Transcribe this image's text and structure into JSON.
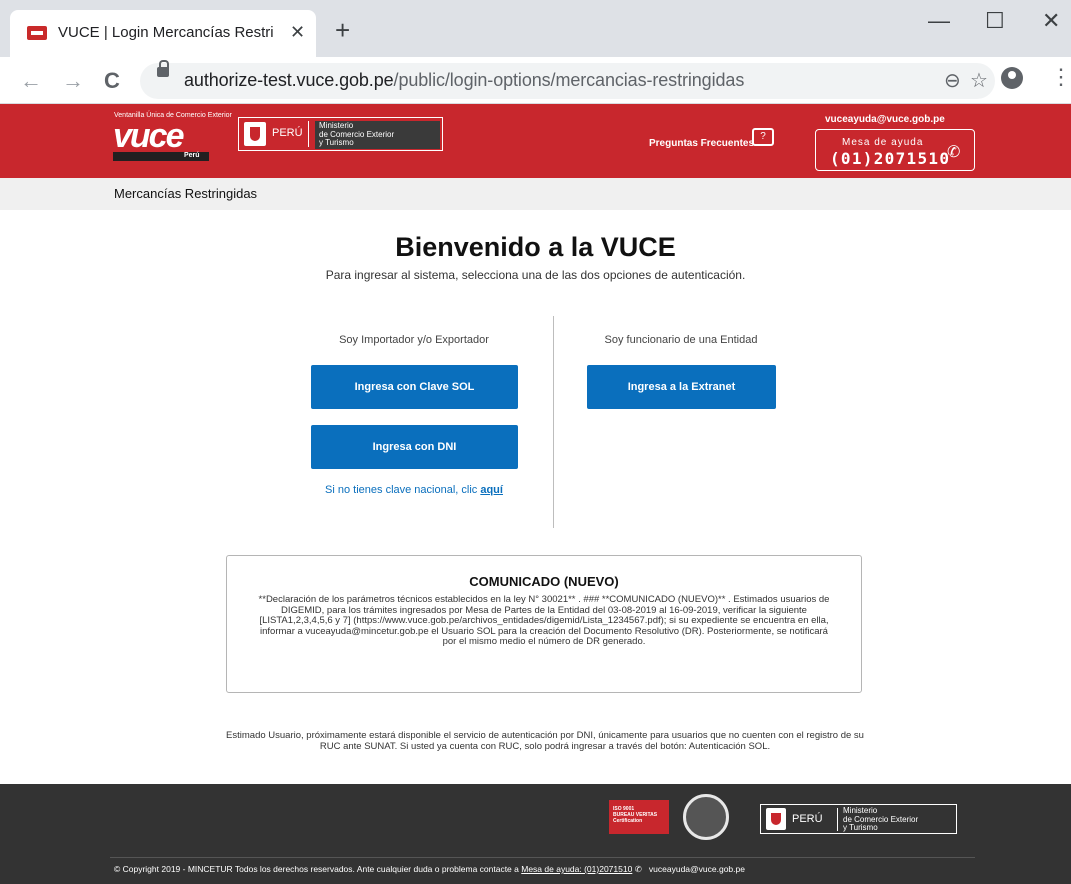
{
  "browser": {
    "tab_title": "VUCE | Login Mercancías Restring",
    "tab_close": "✕",
    "new_tab": "+",
    "win_minimize": "—",
    "win_maximize": "☐",
    "win_close": "✕",
    "back": "←",
    "forward": "→",
    "reload": "C",
    "url_host": "authorize-test.vuce.gob.pe",
    "url_path": "/public/login-options/mercancias-restringidas",
    "zoom_icon": "⊖",
    "star_icon": "☆",
    "menu": "⋮"
  },
  "header": {
    "logo_tagline": "Ventanilla Única de Comercio Exterior",
    "logo_text": "vuce",
    "logo_country": "Perú",
    "gov_country": "PERÚ",
    "gov_ministry_1": "Ministerio",
    "gov_ministry_2": "de Comercio Exterior",
    "gov_ministry_3": "y Turismo",
    "faq_label": "Preguntas Frecuentes",
    "faq_icon_glyph": "?",
    "help_email": "vuceayuda@vuce.gob.pe",
    "help_label": "Mesa de ayuda",
    "help_phone": "(01)2071510",
    "phone_glyph": "✆"
  },
  "subbar": {
    "title": "Mercancías Restringidas"
  },
  "main": {
    "title": "Bienvenido a la VUCE",
    "lead": "Para ingresar al sistema, selecciona una de las dos opciones de autenticación.",
    "left_label": "Soy Importador y/o Exportador",
    "right_label": "Soy funcionario de una Entidad",
    "btn_sol": "Ingresa con Clave SOL",
    "btn_dni": "Ingresa con DNI",
    "btn_extranet": "Ingresa a la Extranet",
    "nokey_text": "Si no tienes clave nacional, clic ",
    "nokey_link": "aquí"
  },
  "comunicado": {
    "title": "COMUNICADO (NUEVO)",
    "body": "**Declaración de los parámetros técnicos establecidos en la ley N° 30021** . ### **COMUNICADO (NUEVO)** . Estimados usuarios de DIGEMID, para los trámites ingresados por Mesa de Partes de la Entidad del 03-08-2019 al 16-09-2019, verificar la siguiente [LISTA1,2,3,4,5,6 y 7] (https://www.vuce.gob.pe/archivos_entidades/digemid/Lista_1234567.pdf); si su expediente se encuentra en ella, informar a vuceayuda@mincetur.gob.pe el Usuario SOL para la creación del Documento Resolutivo (DR). Posteriormente, se notificará por el mismo medio el número de DR generado."
  },
  "notice": "Estimado Usuario, próximamente estará disponible el servicio de autenticación por DNI, únicamente para usuarios que no cuenten con el registro de su RUC ante SUNAT. Si usted ya cuenta con RUC, solo podrá ingresar a través del botón: Autenticación SOL.",
  "footer": {
    "bv_line1": "ISO 9001",
    "bv_line2": "BUREAU VERITAS",
    "bv_line3": "Certification",
    "gov_country": "PERÚ",
    "gov_ministry_1": "Ministerio",
    "gov_ministry_2": "de Comercio Exterior",
    "gov_ministry_3": "y Turismo",
    "copyright": "© Copyright 2019 - MINCETUR Todos los derechos reservados. Ante cualquier duda o problema contacte a ",
    "help_link": "Mesa de ayuda: (01)2071510",
    "phone_glyph": "✆",
    "email": "vuceayuda@vuce.gob.pe"
  },
  "colors": {
    "brand_red": "#c8272d",
    "button_blue": "#0a6fbd",
    "footer_bg": "#333333"
  }
}
